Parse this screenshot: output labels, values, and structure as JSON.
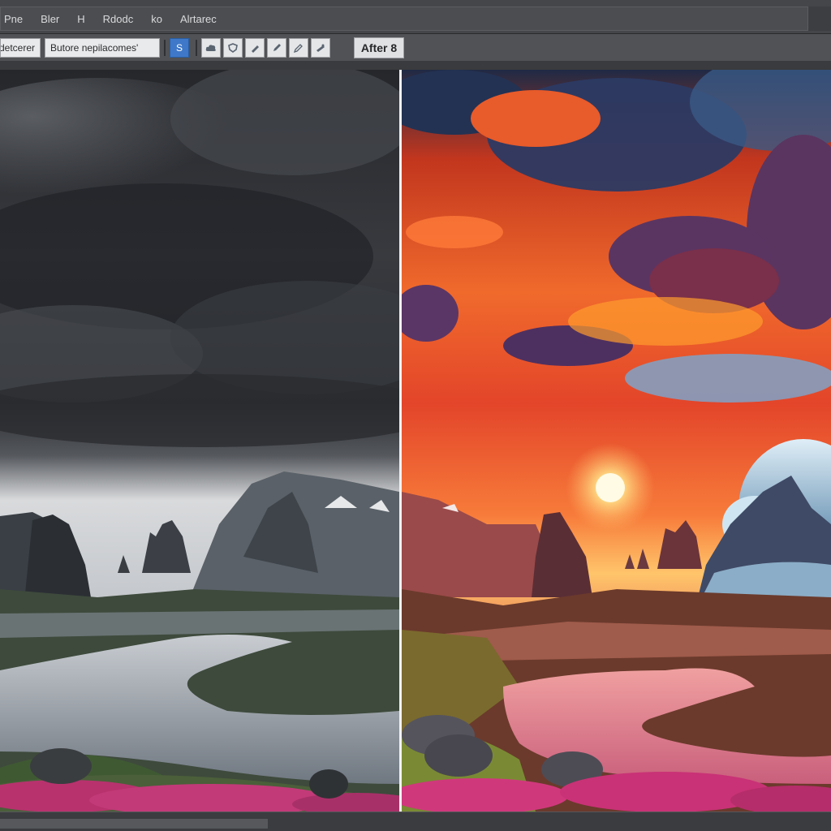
{
  "menu": {
    "items": [
      "Pne",
      "Bler",
      "H",
      "Rdodc",
      "ko",
      "Alrtarec"
    ]
  },
  "toolbar": {
    "left_field": "ldetcerer",
    "before_field": "Butore nepilacomes'",
    "after_label": "After 8",
    "active_tool_glyph": "S"
  },
  "colors": {
    "split_line": "#f2f2f2",
    "active_tool": "#3f78c8"
  },
  "panes": {
    "before": {
      "icon": "stormy-landscape-image"
    },
    "after": {
      "icon": "sunset-landscape-image"
    }
  }
}
